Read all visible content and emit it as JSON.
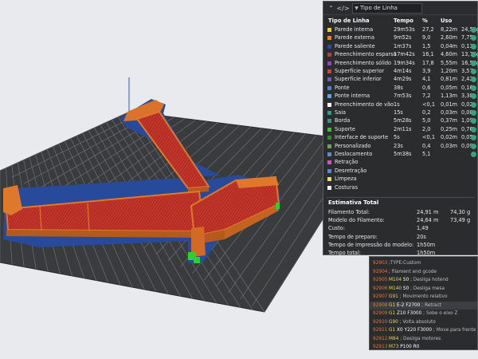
{
  "legend": {
    "view_selector": "Tipo de Linha",
    "headers": {
      "type": "Tipo de Linha",
      "time": "Tempo",
      "percent": "%",
      "use": "Uso"
    },
    "rows": [
      {
        "name": "Parede interna",
        "time": "29m53s",
        "percent": "27,2",
        "length": "8,22m",
        "weight": "24,53g",
        "color": "#f2d11b",
        "visible": true
      },
      {
        "name": "Parede externa",
        "time": "9m52s",
        "percent": "9,0",
        "length": "2,60m",
        "weight": "7,75g",
        "color": "#ff7f00",
        "visible": true
      },
      {
        "name": "Parede saliente",
        "time": "1m37s",
        "percent": "1,5",
        "length": "0,04m",
        "weight": "0,13g",
        "color": "#2b42c9",
        "visible": true
      },
      {
        "name": "Preenchimento esparso",
        "time": "17m42s",
        "percent": "16,1",
        "length": "4,60m",
        "weight": "13,73g",
        "color": "#b93c3c",
        "visible": true
      },
      {
        "name": "Preenchimento sólido",
        "time": "19m34s",
        "percent": "17,8",
        "length": "5,55m",
        "weight": "16,56g",
        "color": "#9b3fc6",
        "visible": true
      },
      {
        "name": "Superfície superior",
        "time": "4m14s",
        "percent": "3,9",
        "length": "1,20m",
        "weight": "3,57g",
        "color": "#e13a3a",
        "visible": true
      },
      {
        "name": "Superfície inferior",
        "time": "4m29s",
        "percent": "4,1",
        "length": "0,81m",
        "weight": "2,42g",
        "color": "#6b5ad3",
        "visible": true
      },
      {
        "name": "Ponte",
        "time": "38s",
        "percent": "0,6",
        "length": "0,05m",
        "weight": "0,16g",
        "color": "#4d7fd6",
        "visible": true
      },
      {
        "name": "Ponte interna",
        "time": "7m53s",
        "percent": "7,2",
        "length": "1,13m",
        "weight": "3,38g",
        "color": "#5aa8e0",
        "visible": true
      },
      {
        "name": "Preenchimento de vão",
        "time": "1s",
        "percent": "<0,1",
        "length": "0,01m",
        "weight": "0,02g",
        "color": "#ffffff",
        "visible": true
      },
      {
        "name": "Saia",
        "time": "15s",
        "percent": "0,2",
        "length": "0,03m",
        "weight": "0,08g",
        "color": "#21a57d",
        "visible": true
      },
      {
        "name": "Borda",
        "time": "5m28s",
        "percent": "5,0",
        "length": "0,37m",
        "weight": "1,09g",
        "color": "#3f8f8f",
        "visible": true
      },
      {
        "name": "Suporte",
        "time": "2m11s",
        "percent": "2,0",
        "length": "0,25m",
        "weight": "0,76g",
        "color": "#1fce1f",
        "visible": true
      },
      {
        "name": "Interface de suporte",
        "time": "5s",
        "percent": "<0,1",
        "length": "0,02m",
        "weight": "0,05g",
        "color": "#2c8d2c",
        "visible": true
      },
      {
        "name": "Personalizado",
        "time": "23s",
        "percent": "0,4",
        "length": "0,03m",
        "weight": "0,09g",
        "color": "#6ea84a",
        "visible": true
      },
      {
        "name": "Deslocamento",
        "time": "5m38s",
        "percent": "5,1",
        "length": "",
        "weight": "",
        "color": "#5a8bd6",
        "visible": true
      },
      {
        "name": "Retração",
        "time": "",
        "percent": "",
        "length": "",
        "weight": "",
        "color": "#e83fe3",
        "visible": false
      },
      {
        "name": "Desretração",
        "time": "",
        "percent": "",
        "length": "",
        "weight": "",
        "color": "#4f8ad8",
        "visible": false
      },
      {
        "name": "Limpeza",
        "time": "",
        "percent": "",
        "length": "",
        "weight": "",
        "color": "#f5e04c",
        "visible": false
      },
      {
        "name": "Costuras",
        "time": "",
        "percent": "",
        "length": "",
        "weight": "",
        "color": "#f2f2f2",
        "visible": false
      }
    ]
  },
  "estimate": {
    "title": "Estimativa Total",
    "rows": [
      {
        "label": "Filamento Total:",
        "v1": "24,91 m",
        "v2": "74,30 g"
      },
      {
        "label": "Modelo do Filamento:",
        "v1": "24,64 m",
        "v2": "73,49 g"
      },
      {
        "label": "Custo:",
        "v1": "1,49",
        "v2": ""
      },
      {
        "label": "Tempo de preparo:",
        "v1": "20s",
        "v2": ""
      },
      {
        "label": "Tempo de impressão do modelo:",
        "v1": "1h50m",
        "v2": ""
      },
      {
        "label": "Tempo total:",
        "v1": "1h50m",
        "v2": ""
      }
    ]
  },
  "gcode": {
    "lines": [
      {
        "num": "92903",
        "cmd": "",
        "args": "",
        "comment": ";TYPE:Custom",
        "highlight": false
      },
      {
        "num": "92904",
        "cmd": "",
        "args": "",
        "comment": "; filament end gcode",
        "highlight": false
      },
      {
        "num": "92905",
        "cmd": "M104",
        "args": "S0",
        "comment": "; Desliga hotend",
        "highlight": false
      },
      {
        "num": "92906",
        "cmd": "M140",
        "args": "S0",
        "comment": "; Desliga mesa",
        "highlight": false
      },
      {
        "num": "92907",
        "cmd": "G91",
        "args": "",
        "comment": "; Movimento relativo",
        "highlight": false
      },
      {
        "num": "92908",
        "cmd": "G1",
        "args": "E-2 F2700",
        "comment": "; Retract",
        "highlight": true
      },
      {
        "num": "92909",
        "cmd": "G1",
        "args": "Z10 F3000",
        "comment": "; Sobe o eixo Z",
        "highlight": false
      },
      {
        "num": "92910",
        "cmd": "G90",
        "args": "",
        "comment": "; Volta absoluto",
        "highlight": false
      },
      {
        "num": "92911",
        "cmd": "G1",
        "args": "X0 Y220 F3000",
        "comment": "; Move para frente",
        "highlight": false
      },
      {
        "num": "92912",
        "cmd": "M84",
        "args": "",
        "comment": "; Desliga motores",
        "highlight": false
      },
      {
        "num": "92913",
        "cmd": "M73",
        "args": "P100 R0",
        "comment": "",
        "highlight": false
      }
    ]
  },
  "colors": {
    "background": "#e9eaed",
    "plate": "#3a3b3d",
    "grid": "#6f7074",
    "panel": "#2b2c2e",
    "model_wall": "#e0782c",
    "model_infill": "#c7362b",
    "support": "#2fcf2f",
    "brim": "#284a9a"
  }
}
